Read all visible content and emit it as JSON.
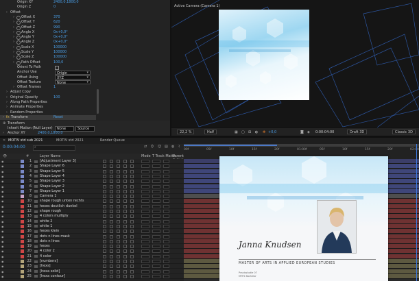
{
  "effects": {
    "rows": [
      {
        "label": "Origin XY",
        "value": "2400,0,1800,0",
        "indent": 3
      },
      {
        "label": "Origin Z",
        "value": "0",
        "indent": 3
      },
      {
        "label": "Offset",
        "value": "",
        "indent": 1,
        "arrow": true
      },
      {
        "label": "Offset X",
        "value": "370",
        "indent": 3,
        "arrow": true,
        "sw": true
      },
      {
        "label": "Offset Y",
        "value": "620",
        "indent": 3,
        "arrow": true,
        "sw": true
      },
      {
        "label": "Offset Z",
        "value": "990",
        "indent": 3,
        "arrow": true,
        "sw": true
      },
      {
        "label": "Angle X",
        "value": "0x+0,0°",
        "indent": 3,
        "arrow": true,
        "sw": true
      },
      {
        "label": "Angle Y",
        "value": "0x+0,0°",
        "indent": 3,
        "arrow": true,
        "sw": true
      },
      {
        "label": "Angle Z",
        "value": "0x+0,0°",
        "indent": 3,
        "arrow": true,
        "sw": true
      },
      {
        "label": "Scale X",
        "value": "100000",
        "indent": 3,
        "arrow": true,
        "sw": true
      },
      {
        "label": "Scale Y",
        "value": "100000",
        "indent": 3,
        "arrow": true,
        "sw": true
      },
      {
        "label": "Scale Z",
        "value": "100000",
        "indent": 3,
        "arrow": true,
        "sw": true
      },
      {
        "label": "Path Offset",
        "value": "100,0",
        "indent": 3,
        "arrow": true,
        "sw": true
      },
      {
        "label": "Orient To Path",
        "value": "",
        "indent": 3,
        "check": true
      },
      {
        "label": "Anchor Use",
        "value": "Origin",
        "indent": 3,
        "dropdown": true
      },
      {
        "label": "Offset Using",
        "value": "XYZ",
        "indent": 3,
        "dropdown": true
      },
      {
        "label": "Offset Texture",
        "value": "None",
        "indent": 3,
        "dropdown": true
      },
      {
        "label": "Offset Frames",
        "value": "1",
        "indent": 3,
        "arrow": true
      },
      {
        "label": "Adjust Copy",
        "value": "",
        "indent": 1,
        "arrow": true
      },
      {
        "label": "Original Opacity",
        "value": "100",
        "indent": 1,
        "arrow": true
      },
      {
        "label": "Along Path Properties",
        "value": "",
        "indent": 1,
        "arrow": true
      },
      {
        "label": "Animate Properties",
        "value": "",
        "indent": 1,
        "arrow": true
      },
      {
        "label": "Random Properties",
        "value": "",
        "indent": 1,
        "arrow": true
      },
      {
        "label": "Transform",
        "value": "Reset",
        "indent": 0,
        "arrow": true,
        "fx": true,
        "selected": true
      }
    ],
    "transform_label": "Transform",
    "inherit_label": "Inherit Motion (Null Layer)",
    "inherit_value": "None",
    "source_value": "Source",
    "anchor_label": "Anchor XY",
    "anchor_value": "2400,0,1800,0"
  },
  "viewer": {
    "camera_label": "Active Camera (Camera 1)",
    "zoom": "22,2 %",
    "quality": "Half",
    "timecode": "0:00:04:00",
    "exposure": "+0,0",
    "renderer": "Draft 3D",
    "view": "Classic 3D"
  },
  "timeline": {
    "tabs": [
      "MOTIV std sub 2021",
      "MOTIV std 2021",
      "Render Queue"
    ],
    "timecode": "0:00:04:00",
    "col_layer": "Layer Name",
    "col_mode": "Mode",
    "col_track": "T Track Matte",
    "col_parent": "Parent & Link",
    "ticks": [
      "00f",
      "05f",
      "10f",
      "15f",
      "20f",
      "01:00f",
      "05f",
      "10f",
      "15f",
      "20f",
      "02:00f"
    ],
    "layers": [
      {
        "num": "1",
        "name": "[Adjustment Layer 3]",
        "color": "#7b8ac8",
        "track": "#3b3e68"
      },
      {
        "num": "2",
        "name": "Shape Layer 6",
        "color": "#7b8ac8",
        "track": "#3f4679"
      },
      {
        "num": "3",
        "name": "Shape Layer 5",
        "color": "#7b8ac8",
        "track": "#3f4679"
      },
      {
        "num": "4",
        "name": "Shape Layer 4",
        "color": "#7b8ac8",
        "track": "#3f4679"
      },
      {
        "num": "5",
        "name": "Shape Layer 3",
        "color": "#7b8ac8",
        "track": "#3f4679"
      },
      {
        "num": "6",
        "name": "Shape Layer 2",
        "color": "#7b8ac8",
        "track": "#3f4679"
      },
      {
        "num": "7",
        "name": "Shape Layer 1",
        "color": "#7b8ac8",
        "track": "#3f4679"
      },
      {
        "num": "8",
        "name": "Camera 1",
        "color": "#c7a2c7",
        "track": "#4e4e4e"
      },
      {
        "num": "10",
        "name": "shape rough unten rechts",
        "color": "#d04646",
        "track": "#6f3232"
      },
      {
        "num": "11",
        "name": "hexes deutlich dunkel",
        "color": "#d04646",
        "track": "#6f3232"
      },
      {
        "num": "12",
        "name": "shape rough",
        "color": "#d04646",
        "track": "#6f3232"
      },
      {
        "num": "13",
        "name": "4 colors multiply",
        "color": "#d04646",
        "track": "#6f3232"
      },
      {
        "num": "14",
        "name": "white 2",
        "color": "#d04646",
        "track": "#6f3232"
      },
      {
        "num": "15",
        "name": "white 1",
        "color": "#d04646",
        "track": "#6f3232"
      },
      {
        "num": "16",
        "name": "hexes klein",
        "color": "#d04646",
        "track": "#6f3232"
      },
      {
        "num": "17",
        "name": "dots n lines mask",
        "color": "#d04646",
        "track": "#6f3232"
      },
      {
        "num": "18",
        "name": "dots n lines",
        "color": "#d04646",
        "track": "#6f3232"
      },
      {
        "num": "19",
        "name": "hexes",
        "color": "#d04646",
        "track": "#6f3232"
      },
      {
        "num": "20",
        "name": "4 color 2",
        "color": "#d04646",
        "track": "#6f3232"
      },
      {
        "num": "21",
        "name": "4 color",
        "color": "#d04646",
        "track": "#6f3232"
      },
      {
        "num": "22",
        "name": "[numbers]",
        "color": "#b4a57a",
        "track": "#5d5940"
      },
      {
        "num": "23",
        "name": "[hexs]",
        "color": "#b4a57a",
        "track": "#5d5940"
      },
      {
        "num": "24",
        "name": "[hexa solid]",
        "color": "#b4a57a",
        "track": "#5d5940"
      },
      {
        "num": "25",
        "name": "[hexa contour]",
        "color": "#b4a57a",
        "track": "#5d5940"
      }
    ]
  },
  "paper": {
    "name": "Janna Knudsen",
    "degree": "MASTER OF ARTS IN APPLIED EUROPEAN STUDIES",
    "line1": "Praxisstudie 07",
    "line2": "MTFS Bachelor"
  },
  "colors": {
    "accent": "#4a9fe8",
    "playhead": "#3d7ae0"
  }
}
